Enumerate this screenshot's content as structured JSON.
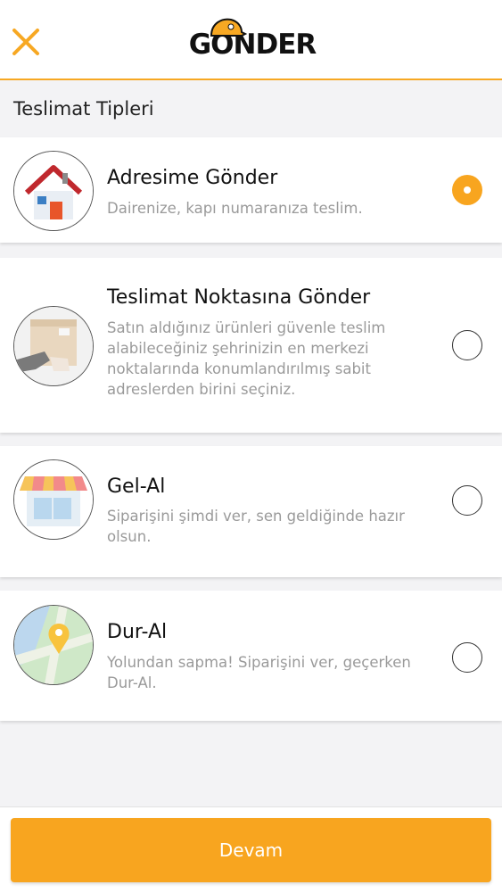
{
  "header": {
    "logo_text": "GÖNDER",
    "close_icon": "close-icon",
    "accent_color": "#f7a823"
  },
  "section_title": "Teslimat Tipleri",
  "options": [
    {
      "title": "Adresime Gönder",
      "description": "Dairenize, kapı numaranıza teslim.",
      "icon": "house-icon",
      "selected": true
    },
    {
      "title": "Teslimat Noktasına Gönder",
      "description": "Satın aldığınız ürünleri güvenle teslim alabileceğiniz şehrinizin en merkezi noktalarında konumlandırılmış sabit adreslerden birini seçiniz.",
      "icon": "package-handoff-icon",
      "selected": false
    },
    {
      "title": "Gel-Al",
      "description": "Siparişini şimdi ver, sen geldiğinde hazır olsun.",
      "icon": "store-icon",
      "selected": false
    },
    {
      "title": "Dur-Al",
      "description": "Yolundan sapma! Siparişini ver, geçerken Dur-Al.",
      "icon": "map-pin-icon",
      "selected": false
    }
  ],
  "continue_label": "Devam",
  "colors": {
    "primary": "#f8a51f",
    "background": "#f3f3f5"
  }
}
